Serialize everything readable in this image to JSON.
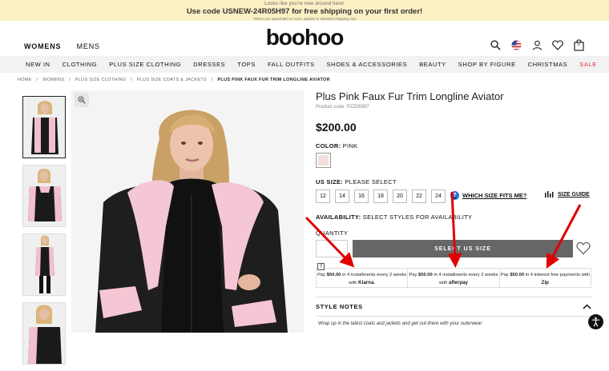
{
  "promo": {
    "line1": "Looks like you're new around here!",
    "line2": "Use code USNEW-24R05H97 for free shipping on your first order!",
    "line3": "*When you spend $50 or more, applies to standard shipping only"
  },
  "header": {
    "nav": [
      {
        "label": "WOMENS",
        "active": true
      },
      {
        "label": "MENS",
        "active": false
      }
    ],
    "logo": "boohoo",
    "bag_count": "0",
    "icons": [
      "search-icon",
      "us-flag-icon",
      "account-icon",
      "wishlist-icon",
      "bag-icon"
    ]
  },
  "categories": [
    "NEW IN",
    "CLOTHING",
    "PLUS SIZE CLOTHING",
    "DRESSES",
    "TOPS",
    "FALL OUTFITS",
    "SHOES & ACCESSORIES",
    "BEAUTY",
    "SHOP BY FIGURE",
    "CHRISTMAS",
    "SALE"
  ],
  "breadcrumb": [
    "HOME",
    "/",
    "WOMENS",
    "/",
    "PLUS SIZE CLOTHING",
    "/",
    "PLUS SIZE COATS & JACKETS",
    "/",
    "PLUS PINK FAUX FUR TRIM LONGLINE AVIATOR"
  ],
  "product": {
    "title": "Plus Pink Faux Fur Trim Longline Aviator",
    "code": "Product code: PZZ05087",
    "price": "$200.00",
    "color_label": "COLOR:",
    "color_value": "PINK",
    "swatch_color": "#f3dede",
    "size_label": "US SIZE:",
    "size_value": "PLEASE SELECT",
    "sizes": [
      "12",
      "14",
      "16",
      "18",
      "20",
      "22",
      "24"
    ],
    "fit_link": "WHICH SIZE FITS ME?",
    "size_guide": "SIZE GUIDE",
    "availability_label": "AVAILABILITY:",
    "availability_value": "SELECT STYLES FOR AVAILABILITY",
    "quantity_label": "QUANTITY",
    "add_button": "SELECT US SIZE",
    "payments": [
      {
        "text_a": "Pay ",
        "amount": "$50.00",
        "text_b": " in 4 installments every 2 weeks with ",
        "brand": "Klarna."
      },
      {
        "text_a": "Pay ",
        "amount": "$50.00",
        "text_b": " in 4 installments every 2 weeks with ",
        "brand": "afterpay"
      },
      {
        "text_a": "Pay ",
        "amount": "$50.00",
        "text_b": " in 4 interest free payments with ",
        "brand": "Zip"
      }
    ],
    "payment_info": "?",
    "style_notes": "STYLE NOTES",
    "description": "Wrap up in the latest coats and jackets and get out-there with your outerwear"
  },
  "colors": {
    "sale": "#d33333",
    "arrow": "#e00000",
    "promo_bg": "#fbf0c4",
    "catnav_bg": "#f2f2f2"
  }
}
